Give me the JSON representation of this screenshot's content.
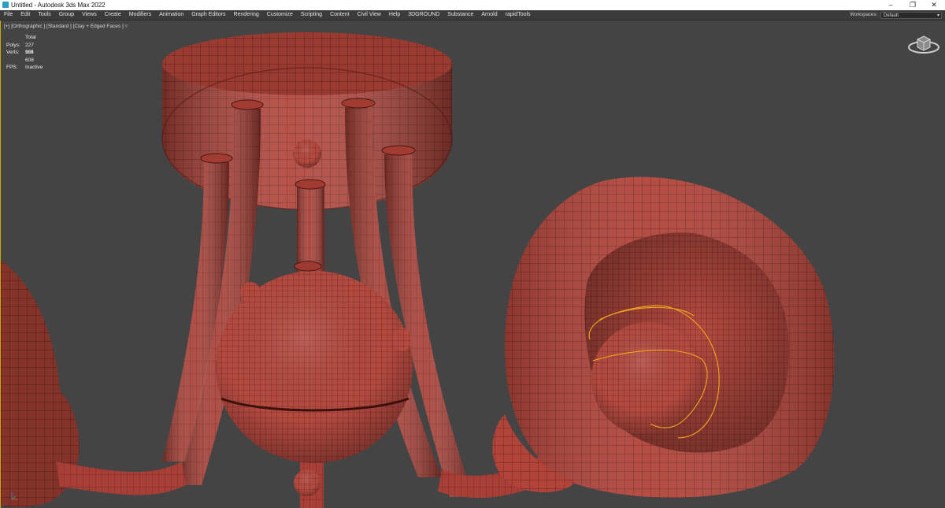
{
  "window": {
    "title": "Untitled - Autodesk 3ds Max 2022",
    "minimize": "–",
    "restore": "❐",
    "close": "✕"
  },
  "menu": {
    "items": [
      "File",
      "Edit",
      "Tools",
      "Group",
      "Views",
      "Create",
      "Modifiers",
      "Animation",
      "Graph Editors",
      "Rendering",
      "Customize",
      "Scripting",
      "Content",
      "Civil View",
      "Help",
      "3DGROUND",
      "Substance",
      "Arnold",
      "rapidTools"
    ],
    "workspaces_label": "Workspaces:",
    "workspace_value": "Default"
  },
  "viewport": {
    "label": "[+] [Orthographic ] [Standard ] [Clay + Edged Faces ]",
    "stats": {
      "header": "Total",
      "polys_label": "Polys:",
      "polys_value": "227 904",
      "verts_label": "Verts:",
      "verts_value": "115 608",
      "fps_label": "FPS:",
      "fps_value": "Inactive"
    }
  },
  "colors": {
    "viewport_bg": "#444444",
    "clay": "#b0443a",
    "wire": "#5a1a16",
    "selection_spline": "#f0a020"
  },
  "icons": {
    "viewcube": "viewcube-icon",
    "axis_tripod": "axis-tripod-icon",
    "filter": "filter-icon"
  }
}
